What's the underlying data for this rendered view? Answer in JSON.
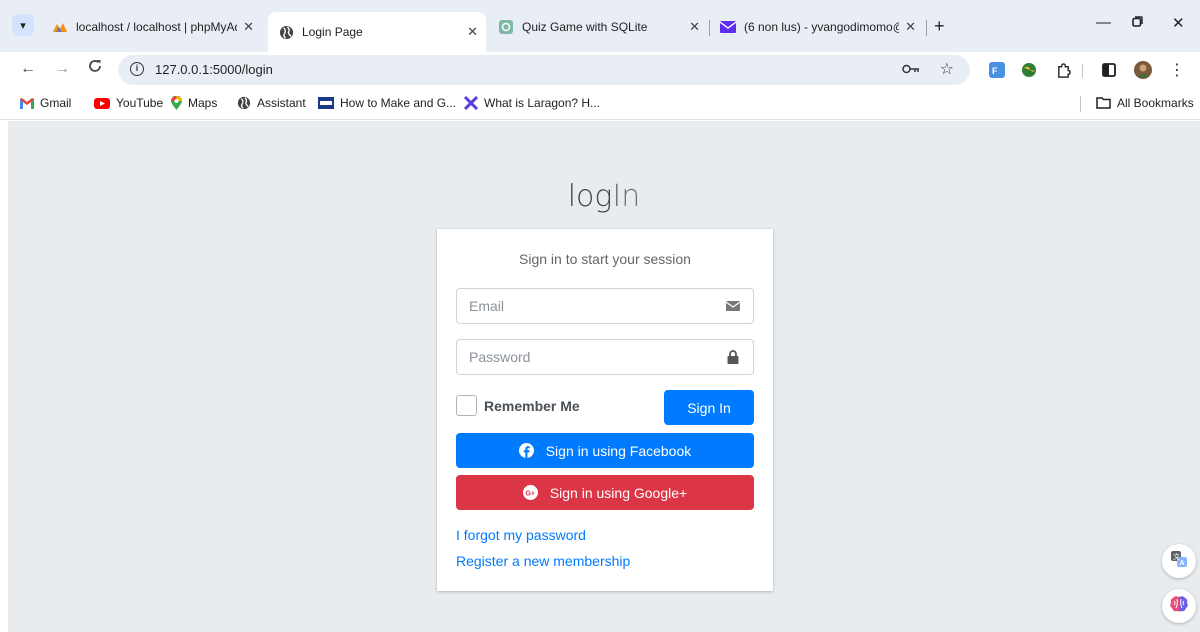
{
  "tabs": [
    {
      "title": "localhost / localhost | phpMyAd",
      "close": "✕"
    },
    {
      "title": "Login Page",
      "close": "✕"
    },
    {
      "title": "Quiz Game with SQLite",
      "close": "✕"
    },
    {
      "title": "(6 non lus) - yvangodimomo@y",
      "close": "✕"
    }
  ],
  "toolbar": {
    "url": "127.0.0.1:5000/login"
  },
  "bookmarks": [
    {
      "label": "Gmail"
    },
    {
      "label": "YouTube"
    },
    {
      "label": "Maps"
    },
    {
      "label": "Assistant"
    },
    {
      "label": "How to Make and G..."
    },
    {
      "label": "What is Laragon? H..."
    }
  ],
  "all_bookmarks": "All Bookmarks",
  "login": {
    "logo_bold": "log",
    "logo_light": "In",
    "message": "Sign in to start your session",
    "email_placeholder": "Email",
    "password_placeholder": "Password",
    "remember_label": "Remember Me",
    "signin_label": "Sign In",
    "facebook_label": "Sign in using Facebook",
    "google_label": "Sign in using Google+",
    "forgot_link": "I forgot my password",
    "register_link": "Register a new membership"
  },
  "colors": {
    "primary": "#007bff",
    "danger": "#dc3545",
    "page_bg": "#e9ecef",
    "tabstrip_bg": "#e9eef6"
  }
}
